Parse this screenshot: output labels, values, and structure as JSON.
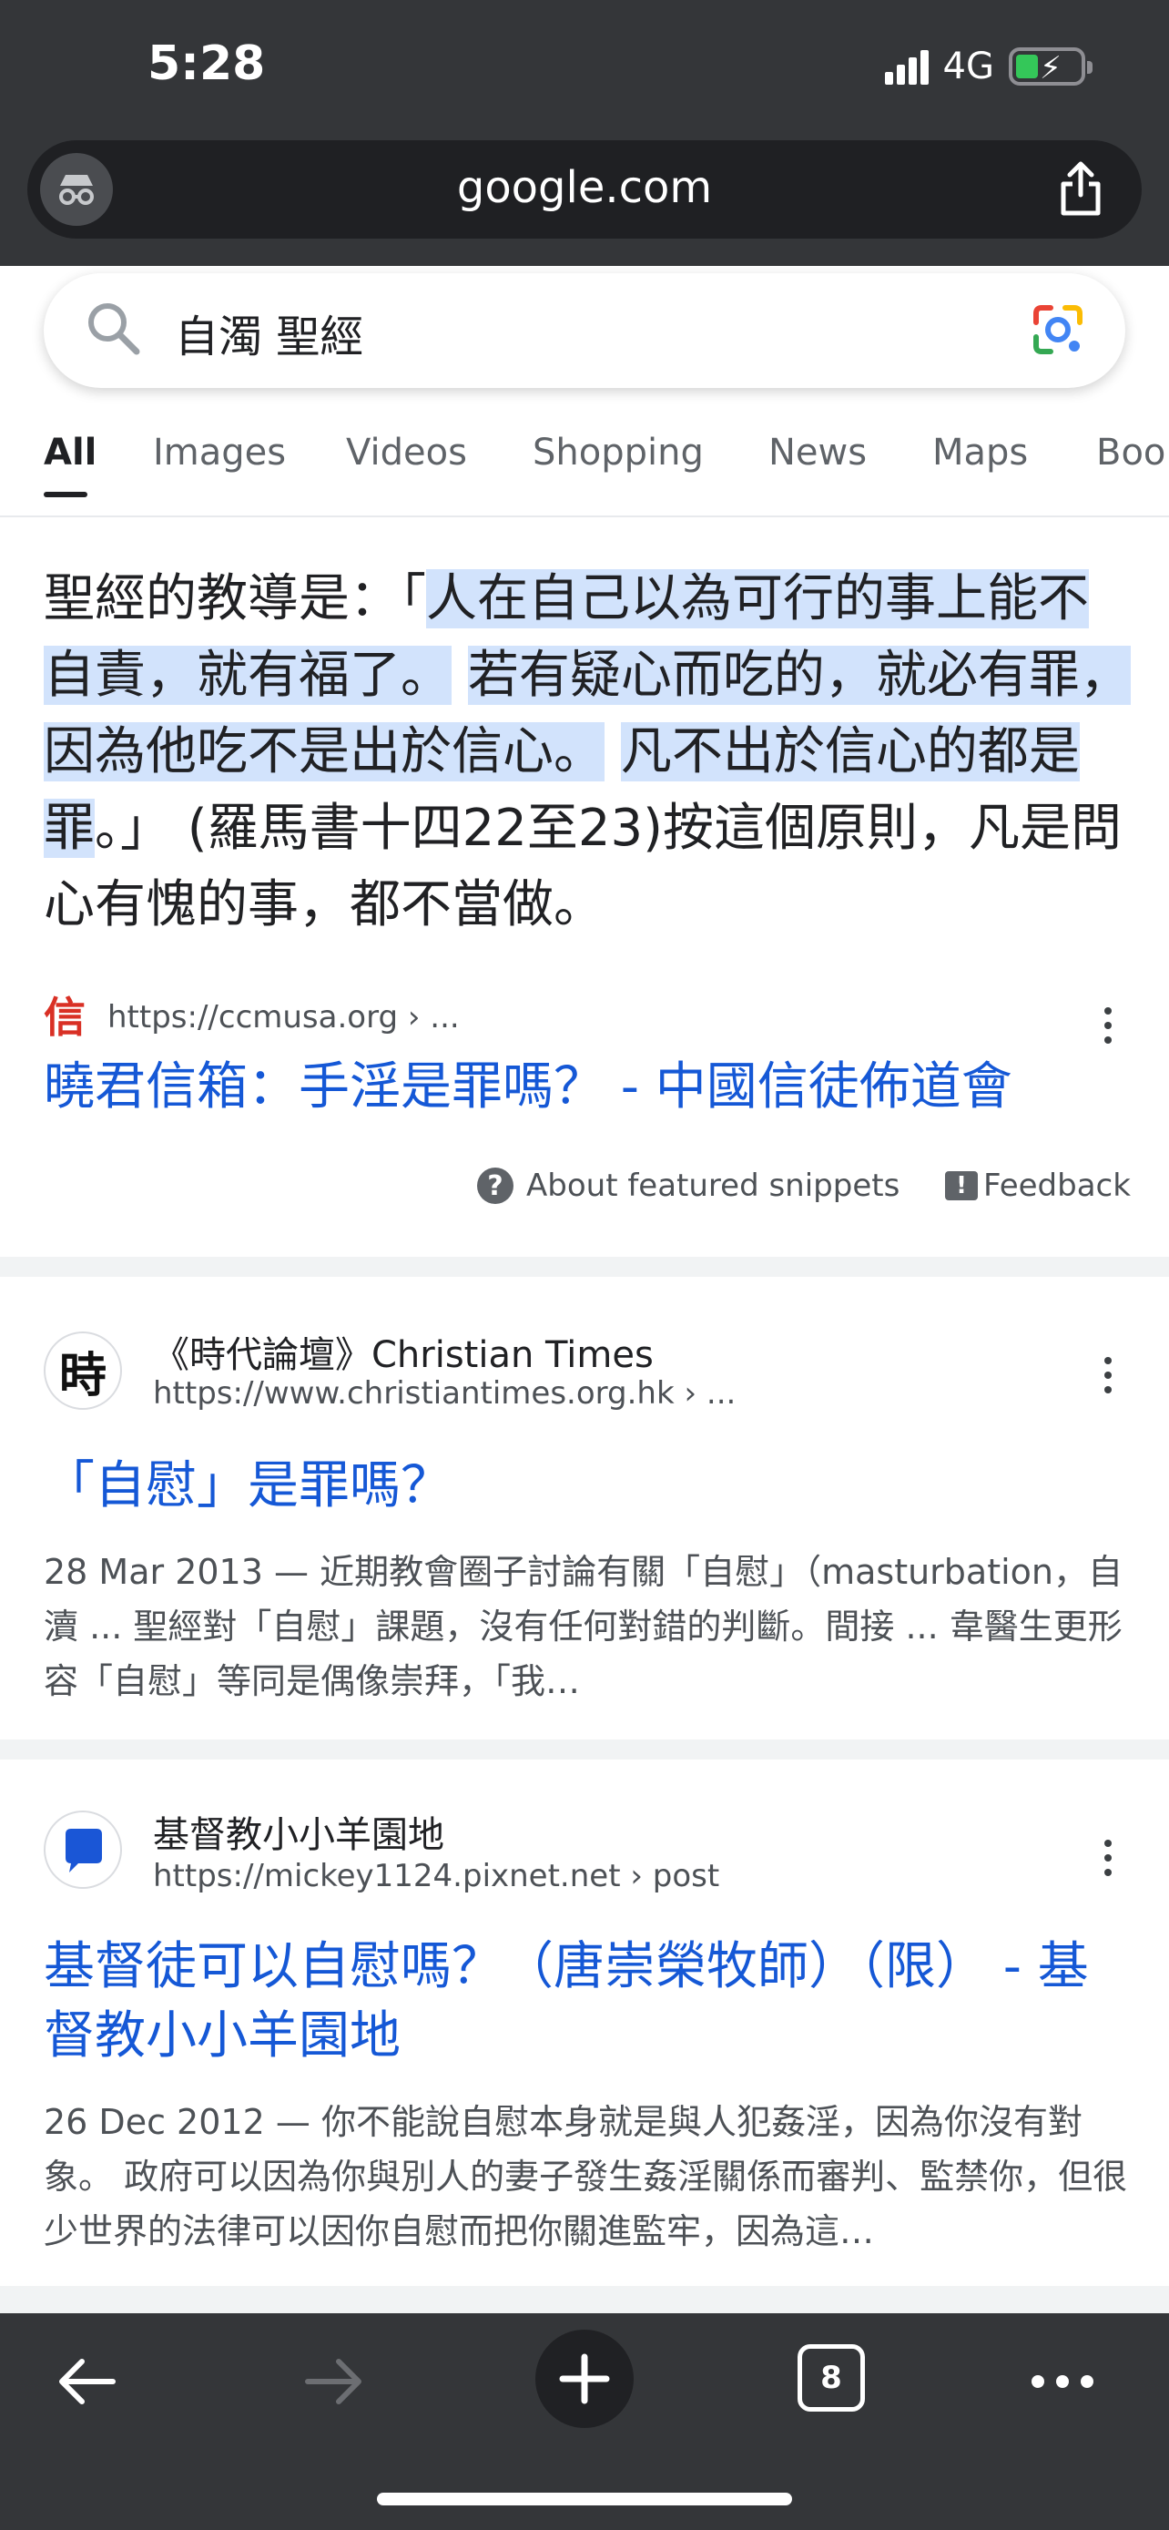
{
  "status_bar": {
    "time": "5:28",
    "network": "4G"
  },
  "url_bar": {
    "domain": "google.com"
  },
  "search": {
    "query": "自濁 聖經"
  },
  "tabs": [
    {
      "label": "All"
    },
    {
      "label": "Images"
    },
    {
      "label": "Videos"
    },
    {
      "label": "Shopping"
    },
    {
      "label": "News"
    },
    {
      "label": "Maps"
    },
    {
      "label": "Boo"
    }
  ],
  "featured": {
    "prefix": "聖經的教導是：「",
    "quote_1": "人在自己以為可行的事上能不自責，就有福了。",
    "quote_2": "若有疑心而吃的，就必有罪，因為他吃不是出於信心。",
    "quote_3": "凡不出於信心的都是罪",
    "suffix": "。」 (羅馬書十四22至23)按這個原則，凡是問心有愧的事，都不當做。",
    "source_favicon_text": "信",
    "source_url": "https://ccmusa.org › ...",
    "title": "曉君信箱：手淫是罪嗎？ - 中國信徒佈道會",
    "about_label": "About featured snippets",
    "feedback_label": "Feedback"
  },
  "results": [
    {
      "logo_text": "時",
      "site_name": "《時代論壇》Christian Times",
      "url": "https://www.christiantimes.org.hk › ...",
      "title": "「自慰」是罪嗎？",
      "date": "28 Mar 2013",
      "snippet": "近期教會圈子討論有關「自慰」（masturbation，自瀆 ... 聖經對「自慰」課題，沒有任何對錯的判斷。間接 ... 韋醫生更形容「自慰」等同是偶像崇拜，「我…"
    },
    {
      "logo_text": "",
      "site_name": "基督教小小羊園地",
      "url": "https://mickey1124.pixnet.net › post",
      "title": "基督徒可以自慰嗎？（唐崇榮牧師）（限） - 基督教小小羊園地",
      "date": "26 Dec 2012",
      "snippet": "你不能說自慰本身就是與人犯姦淫，因為你沒有對象。 政府可以因為你與別人的妻子發生姦淫關係而審判、監禁你，但很少世界的法律可以因你自慰而把你關進監牢，因為這…"
    }
  ],
  "toolbar": {
    "tab_count": "8"
  },
  "colors": {
    "chrome": "#343639",
    "link": "#1558d6",
    "highlight": "#d2e3fc",
    "favicon_red": "#d93025"
  }
}
